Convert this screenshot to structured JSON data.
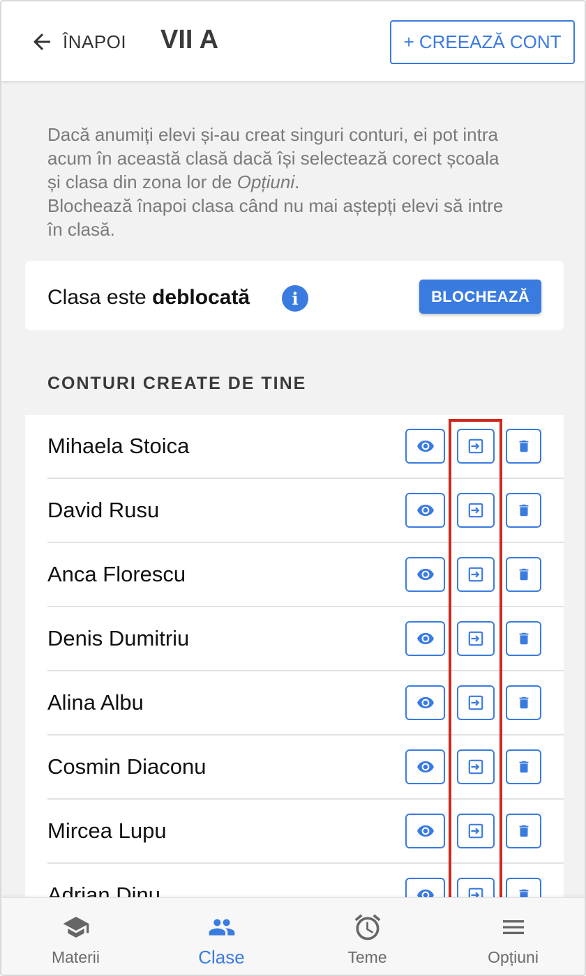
{
  "header": {
    "back_label": "ÎNAPOI",
    "title": "VII A",
    "create_button_label": "+ CREEAZĂ CONT"
  },
  "info": {
    "line1": "Dacă anumiți elevi și-au creat singuri conturi, ei pot intra",
    "line2": "acum în această clasă dacă își selectează corect școala",
    "line3_prefix": "și clasa din zona lor de ",
    "line3_italic": "Opțiuni",
    "line3_suffix": ".",
    "line4": "Blochează înapoi clasa când nu mai aștepți elevi să intre",
    "line5": "în clasă."
  },
  "lock_card": {
    "status_prefix": "Clasa este ",
    "status_bold": "deblocată",
    "info_icon": "info-icon",
    "button_label": "BLOCHEAZĂ"
  },
  "section": {
    "title": "CONTURI CREATE DE TINE"
  },
  "students": [
    {
      "name": "Mihaela Stoica"
    },
    {
      "name": "David Rusu"
    },
    {
      "name": "Anca Florescu"
    },
    {
      "name": "Denis Dumitriu"
    },
    {
      "name": "Alina Albu"
    },
    {
      "name": "Cosmin Diaconu"
    },
    {
      "name": "Mircea Lupu"
    },
    {
      "name": "Adrian Dinu"
    }
  ],
  "row_actions": {
    "view_icon": "eye-icon",
    "enter_icon": "login-icon",
    "delete_icon": "trash-icon"
  },
  "bottom_nav": [
    {
      "label": "Materii",
      "icon": "graduation-cap-icon",
      "active": false
    },
    {
      "label": "Clase",
      "icon": "people-icon",
      "active": true
    },
    {
      "label": "Teme",
      "icon": "alarm-clock-icon",
      "active": false
    },
    {
      "label": "Opțiuni",
      "icon": "menu-icon",
      "active": false
    }
  ],
  "colors": {
    "accent": "#3a7be0",
    "highlight": "#d0281c",
    "background": "#f2f2f2"
  }
}
